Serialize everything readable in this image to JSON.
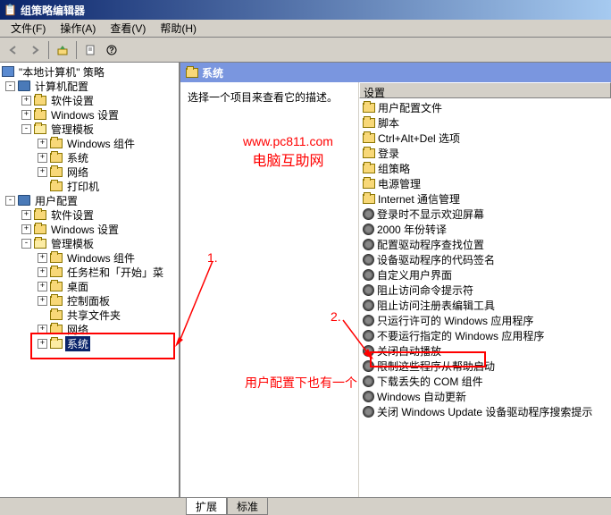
{
  "window": {
    "title": "组策略编辑器"
  },
  "menu": {
    "file": "文件(F)",
    "action": "操作(A)",
    "view": "查看(V)",
    "help": "帮助(H)"
  },
  "tree": {
    "root": "\"本地计算机\" 策略",
    "computer_config": "计算机配置",
    "software_settings": "软件设置",
    "windows_settings": "Windows 设置",
    "admin_templates": "管理模板",
    "windows_components": "Windows 组件",
    "system": "系统",
    "network": "网络",
    "printers": "打印机",
    "user_config": "用户配置",
    "taskbar_start": "任务栏和「开始」菜",
    "desktop": "桌面",
    "control_panel": "控制面板",
    "shared_folders": "共享文件夹"
  },
  "right": {
    "header": "系统",
    "desc": "选择一个项目来查看它的描述。",
    "col_header": "设置",
    "items": [
      "用户配置文件",
      "脚本",
      "Ctrl+Alt+Del 选项",
      "登录",
      "组策略",
      "电源管理",
      "Internet 通信管理",
      "登录时不显示欢迎屏幕",
      "2000 年份转译",
      "配置驱动程序查找位置",
      "设备驱动程序的代码签名",
      "自定义用户界面",
      "阻止访问命令提示符",
      "阻止访问注册表编辑工具",
      "只运行许可的 Windows 应用程序",
      "不要运行指定的 Windows 应用程序",
      "关闭自动播放",
      "限制这些程序从帮助启动",
      "下载丢失的 COM 组件",
      "Windows 自动更新",
      "关闭 Windows Update 设备驱动程序搜索提示"
    ]
  },
  "tabs": {
    "extended": "扩展",
    "standard": "标准"
  },
  "annot": {
    "n1": "1.",
    "n2": "2.",
    "msg": "用户配置下也有一个",
    "wm1": "www.pc811.com",
    "wm2": "电脑互助网"
  }
}
